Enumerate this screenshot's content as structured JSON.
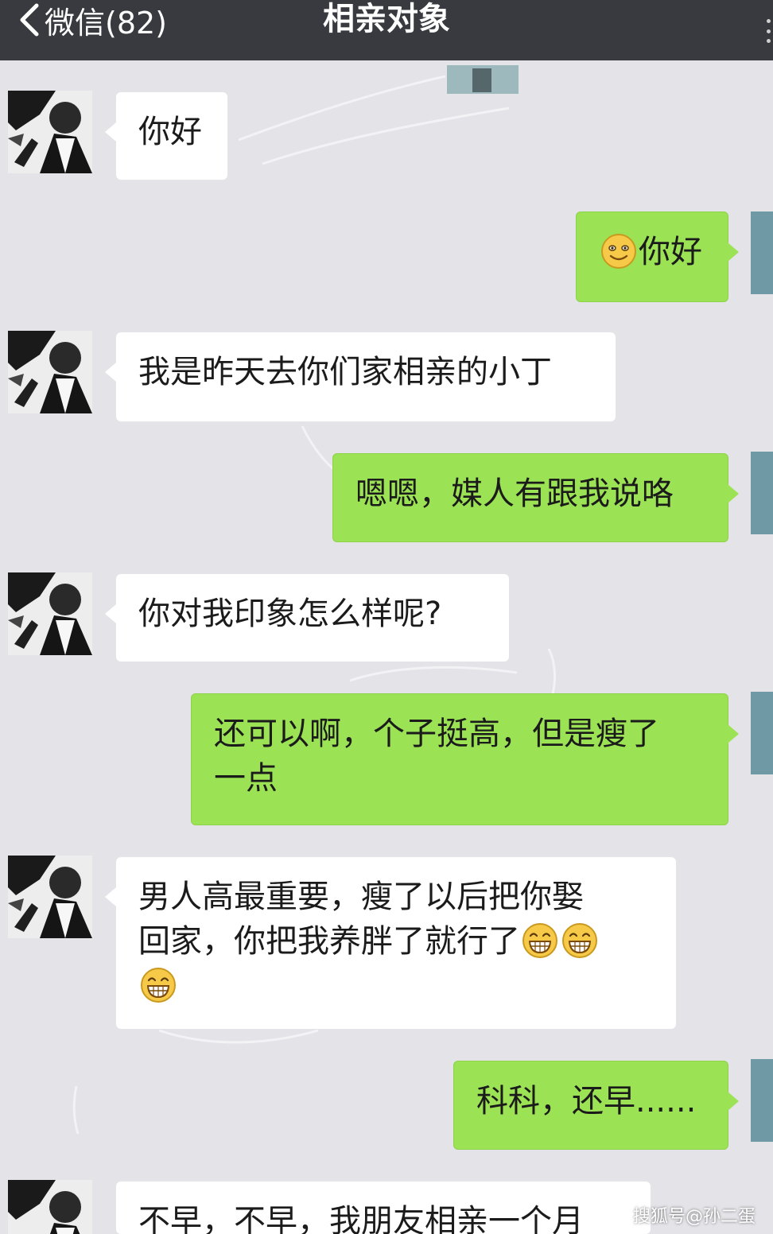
{
  "header": {
    "back_label": "微信(82)",
    "title": "相亲对象"
  },
  "messages": [
    {
      "side": "in",
      "text": "你好"
    },
    {
      "side": "out",
      "emoji": "smile-emoji",
      "text": "你好"
    },
    {
      "side": "in",
      "text": "我是昨天去你们家相亲的小丁"
    },
    {
      "side": "out",
      "text": "嗯嗯，媒人有跟我说咯"
    },
    {
      "side": "in",
      "text": "你对我印象怎么样呢?"
    },
    {
      "side": "out",
      "line1": "还可以啊，个子挺高，但是瘦了",
      "line2": "一点"
    },
    {
      "side": "in",
      "line1": "男人高最重要，瘦了以后把你娶",
      "line2": "回家，你把我养胖了就行了",
      "emoji": "grin-emoji"
    },
    {
      "side": "out",
      "text": "科科，还早......"
    },
    {
      "side": "in",
      "text": "不早，不早，我朋友相亲一个月"
    }
  ],
  "footer": {
    "watermark": "搜狐号@孙二蛋"
  }
}
